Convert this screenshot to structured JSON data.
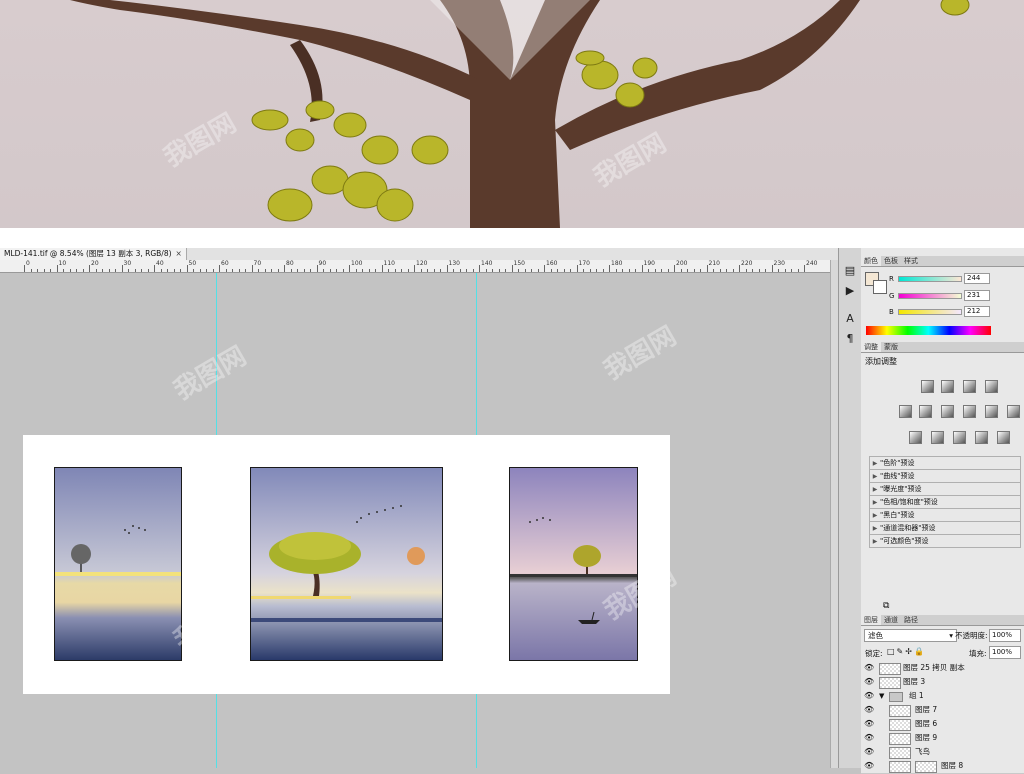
{
  "document": {
    "tab_title": "MLD-141.tif @ 8.54% (图层 13 副本 3, RGB/8)",
    "close_symbol": "×"
  },
  "ruler": {
    "ticks": [
      "0",
      "10",
      "20",
      "30",
      "40",
      "50",
      "60",
      "70",
      "80",
      "90",
      "100",
      "110",
      "120",
      "130",
      "140",
      "150",
      "160",
      "170",
      "180",
      "190",
      "200",
      "210",
      "220",
      "230",
      "240"
    ]
  },
  "color_panel": {
    "tabs": [
      "颜色",
      "色板",
      "样式"
    ],
    "channels": [
      {
        "label": "R",
        "value": "244"
      },
      {
        "label": "G",
        "value": "231"
      },
      {
        "label": "B",
        "value": "212"
      }
    ],
    "foreground_color": "#f4e7d4"
  },
  "adjust_panel": {
    "tabs": [
      "调整",
      "蒙版"
    ],
    "title": "添加调整",
    "presets": [
      "\"色阶\"预设",
      "\"曲线\"预设",
      "\"曝光度\"预设",
      "\"色相/饱和度\"预设",
      "\"黑白\"预设",
      "\"通道混和器\"预设",
      "\"可选颜色\"预设"
    ]
  },
  "layers_panel": {
    "tabs": [
      "图层",
      "通道",
      "路径"
    ],
    "blend_mode": "滤色",
    "opacity_label": "不透明度:",
    "opacity_value": "100%",
    "lock_label": "锁定:",
    "fill_label": "填充:",
    "fill_value": "100%",
    "layers": [
      {
        "name": "图层 25 拷贝 副本",
        "indent": false
      },
      {
        "name": "图层 3",
        "indent": false
      },
      {
        "name": "组 1",
        "indent": false,
        "group": true
      },
      {
        "name": "图层 7",
        "indent": true
      },
      {
        "name": "图层 6",
        "indent": true
      },
      {
        "name": "图层 9",
        "indent": true
      },
      {
        "name": "飞鸟",
        "indent": true
      },
      {
        "name": "图层 8",
        "indent": true
      }
    ]
  },
  "watermark": "我图网"
}
